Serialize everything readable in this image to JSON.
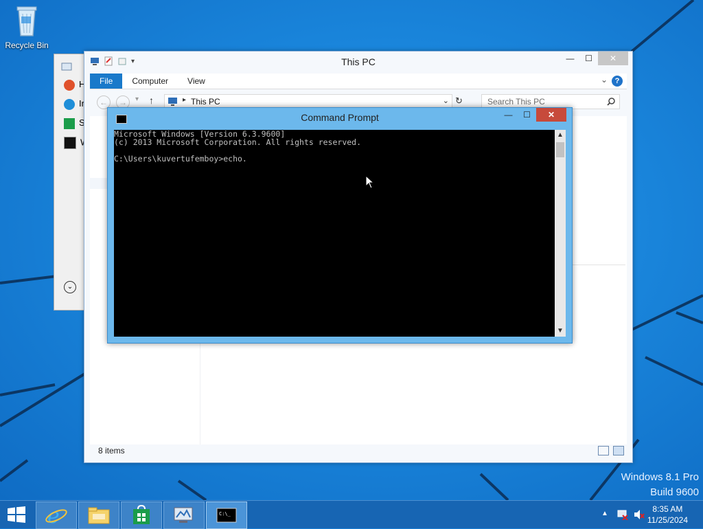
{
  "desktop": {
    "recycle_bin_label": "Recycle Bin",
    "watermark_line1": "Windows 8.1 Pro",
    "watermark_line2": "Build 9600",
    "background_color": "#1a86dc"
  },
  "explorer": {
    "title": "This PC",
    "tabs": [
      "File",
      "Computer",
      "View"
    ],
    "address": "This PC",
    "search_placeholder": "Search This PC",
    "status": "8 items",
    "help_label": "?",
    "back_window_letters": [
      "H",
      "Ir",
      "S",
      "W"
    ]
  },
  "cmd": {
    "title": "Command Prompt",
    "lines": [
      "Microsoft Windows [Version 6.3.9600]",
      "(c) 2013 Microsoft Corporation. All rights reserved.",
      "",
      "C:\\Users\\kuvertufemboy>echo."
    ]
  },
  "taskbar": {
    "time": "8:35 AM",
    "date": "11/25/2024",
    "pinned": [
      "internet-explorer",
      "file-explorer",
      "store",
      "remote-desktop",
      "command-prompt"
    ],
    "accent": "#1765b3"
  }
}
